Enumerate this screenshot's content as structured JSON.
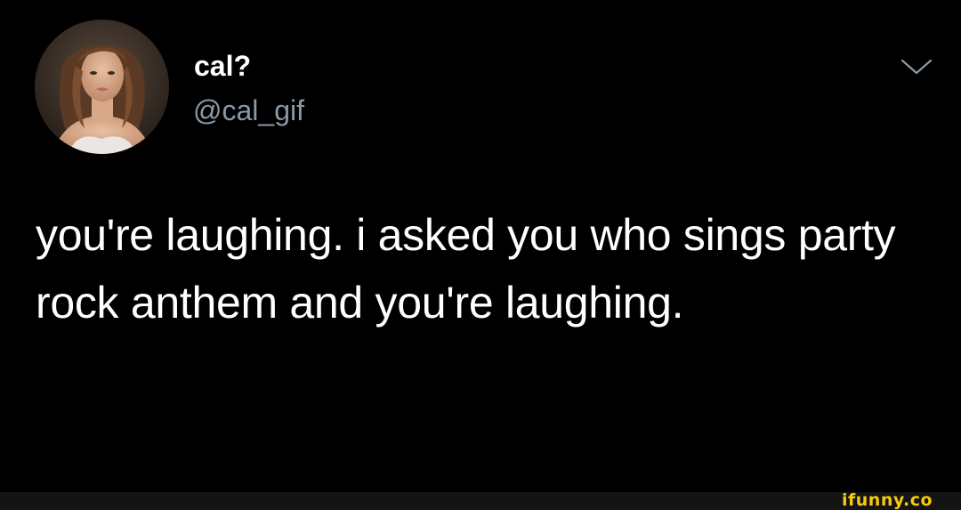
{
  "tweet": {
    "display_name": "cal?",
    "handle": "@cal_gif",
    "text": "you're laughing. i asked you who sings party rock anthem and you're laughing.",
    "avatar_icon": "profile-photo",
    "more_icon": "chevron-down-icon"
  },
  "watermark": {
    "text": "ifunny.co",
    "color": "#f6c90e"
  },
  "colors": {
    "background": "#000000",
    "primary_text": "#ffffff",
    "secondary_text": "#8b98a5",
    "footer": "#141414"
  }
}
